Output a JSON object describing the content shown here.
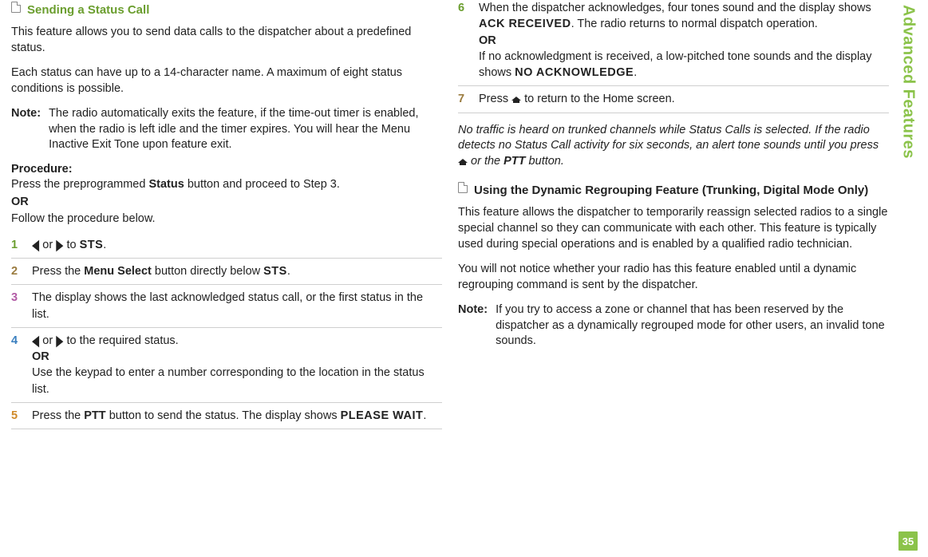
{
  "sidebar": {
    "label": "Advanced Features",
    "page": "35"
  },
  "left": {
    "title": "Sending a Status Call",
    "p1": "This feature allows you to send data calls to the dispatcher about a predefined status.",
    "p2": "Each status can have up to a 14-character name. A maximum of eight status conditions is possible.",
    "note_label": "Note:",
    "note_text": "The radio automatically exits the feature, if the time-out timer is enabled, when the radio is left idle and the timer expires. You will hear the Menu Inactive Exit Tone upon feature exit.",
    "procedure_label": "Procedure:",
    "proc_line1a": "Press the preprogrammed ",
    "proc_line1b": "Status",
    "proc_line1c": " button and proceed to Step 3.",
    "or": "OR",
    "proc_line2": "Follow the procedure below.",
    "s1_a": " or ",
    "s1_b": " to ",
    "sts": "STS",
    "period": ".",
    "s2_a": "Press the ",
    "s2_b": "Menu Select",
    "s2_c": " button directly below ",
    "s3": "The display shows the last acknowledged status call, or the first status in the list.",
    "s4_a": " or ",
    "s4_b": " to the required status.",
    "s4_c": "Use the keypad to enter a number corresponding to the location in the status list.",
    "s5_a": "Press the ",
    "s5_b": "PTT",
    "s5_c": " button to send the status. The display shows ",
    "please_wait": "PLEASE WAIT"
  },
  "right": {
    "s6_a": "When the dispatcher acknowledges, four tones sound and the display shows ",
    "ack": "ACK RECEIVED",
    "s6_b": ". The radio returns to normal dispatch operation.",
    "s6_c": "If no acknowledgment is received, a low-pitched tone sounds and the display shows ",
    "noack": "NO ACKNOWLEDGE",
    "s7_a": "Press ",
    "s7_b": " to return to the Home screen.",
    "italic_a": "No traffic is heard on trunked channels while Status Calls is selected. If the radio detects no Status Call activity for six seconds, an alert tone sounds until you press ",
    "italic_b": " or the ",
    "ptt": "PTT",
    "italic_c": " button.",
    "title2": "Using the Dynamic Regrouping Feature (Trunking, Digital Mode Only)",
    "p1": "This feature allows the dispatcher to temporarily reassign selected radios to a single special channel so they can communicate with each other. This feature is typically used during special operations and is enabled by a qualified radio technician.",
    "p2": "You will not notice whether your radio has this feature enabled until a dynamic regrouping command is sent by the dispatcher.",
    "note_label": "Note:",
    "note_text": "If you try to access a zone or channel that has been reserved by the dispatcher as a dynamically regrouped mode for other users, an invalid tone sounds."
  },
  "nums": {
    "n1": "1",
    "n2": "2",
    "n3": "3",
    "n4": "4",
    "n5": "5",
    "n6": "6",
    "n7": "7"
  }
}
